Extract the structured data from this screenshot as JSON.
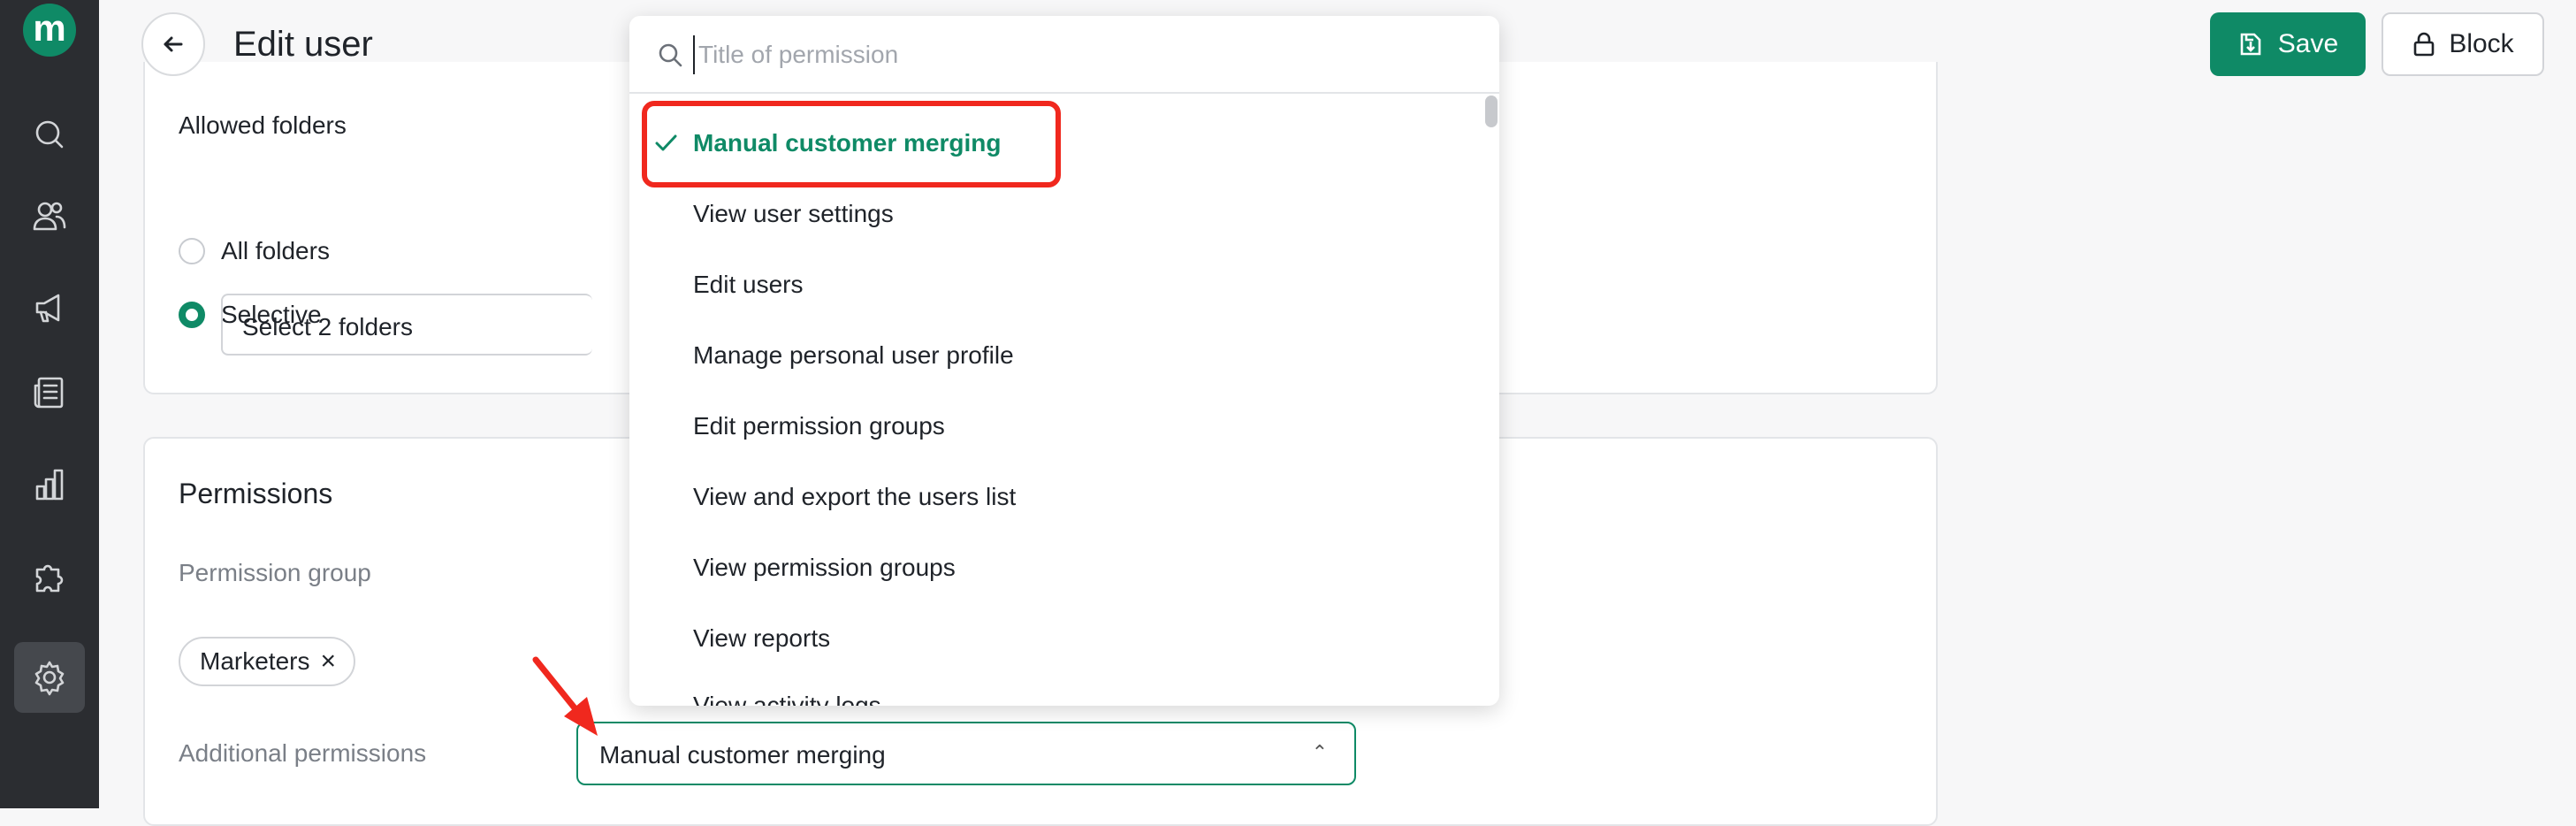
{
  "brand": {
    "logo_letter": "m",
    "accent": "#0f8a66"
  },
  "sidebar": {
    "items": [
      {
        "icon": "search-icon"
      },
      {
        "icon": "users-icon"
      },
      {
        "icon": "megaphone-icon"
      },
      {
        "icon": "newspaper-icon"
      },
      {
        "icon": "bar-chart-icon"
      },
      {
        "icon": "puzzle-icon"
      },
      {
        "icon": "gear-icon",
        "active": true
      }
    ]
  },
  "header": {
    "title": "Edit user",
    "save_label": "Save",
    "block_label": "Block"
  },
  "folders": {
    "heading": "Allowed folders",
    "options": [
      "All folders",
      "Selective"
    ],
    "selected": "Selective",
    "select_value": "Select 2 folders"
  },
  "permissions": {
    "heading": "Permissions",
    "group_label": "Permission group",
    "group_chip": "Marketers",
    "chip_remove": "×",
    "additional_label": "Additional permissions",
    "additional_value": "Manual customer merging"
  },
  "dropdown": {
    "search_placeholder": "Title of permission",
    "items": [
      "Manual customer merging",
      "View user settings",
      "Edit users",
      "Manage personal user profile",
      "Edit permission groups",
      "View and export the users list",
      "View permission groups",
      "View reports"
    ],
    "selected": "Manual customer merging",
    "partial_item": "View activity logs"
  },
  "annotation_color": "#f0281e"
}
